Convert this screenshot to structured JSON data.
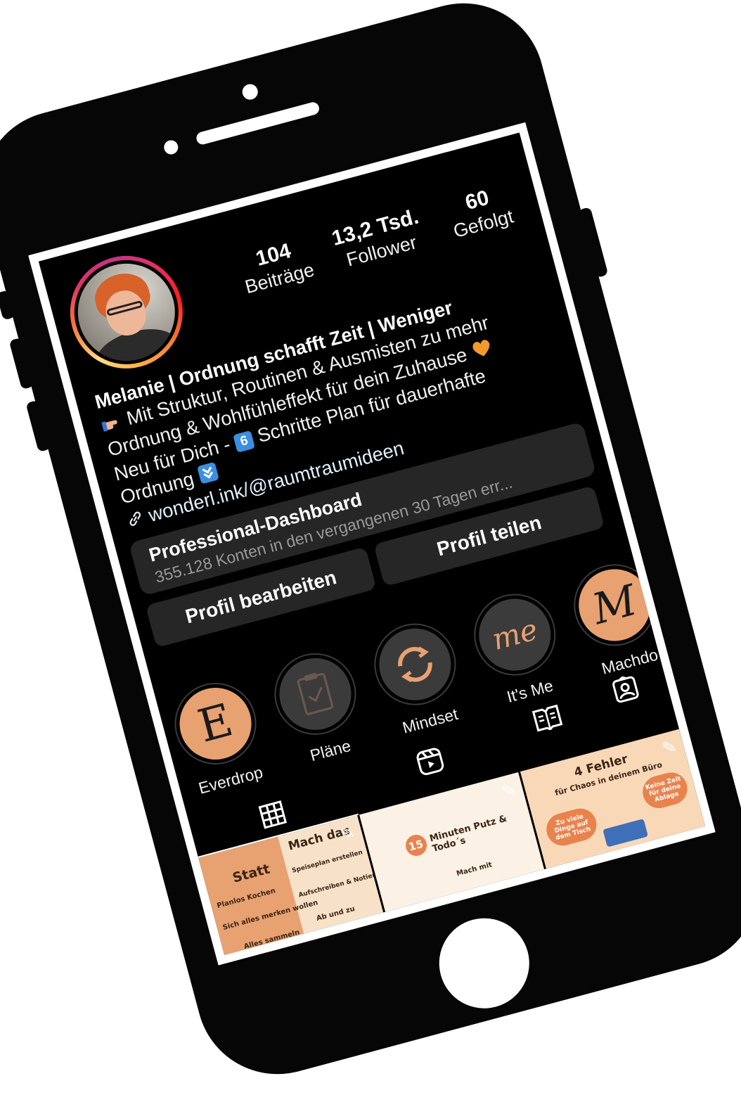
{
  "profile": {
    "stats": [
      {
        "value": "104",
        "label": "Beiträge"
      },
      {
        "value": "13,2 Tsd.",
        "label": "Follower"
      },
      {
        "value": "60",
        "label": "Gefolgt"
      }
    ],
    "bio": {
      "name": "Melanie | Ordnung schafft Zeit | Weniger",
      "line1": "Mit Struktur, Routinen & Ausmisten zu mehr",
      "line2": "Ordnung & Wohlfühleffekt für dein Zuhause",
      "line3_prefix": "Neu für Dich - ",
      "line3_number": "6",
      "line3_suffix": " Schritte Plan für dauerhafte",
      "line4": "Ordnung"
    },
    "link": "wonderl.ink/@raumtraumideen"
  },
  "dashboard": {
    "title": "Professional-Dashboard",
    "subtitle": "355.128 Konten in den vergangenen 30 Tagen err..."
  },
  "buttons": {
    "edit": "Profil bearbeiten",
    "share": "Profil teilen"
  },
  "highlights": [
    {
      "label": "Everdrop",
      "glyph": "E"
    },
    {
      "label": "Pläne"
    },
    {
      "label": "Mindset"
    },
    {
      "label": "It's Me",
      "glyph": "me"
    },
    {
      "label": "Machdo",
      "glyph": "M"
    }
  ],
  "tabs": [
    {
      "icon": "grid-icon"
    },
    {
      "icon": "reels-icon"
    },
    {
      "icon": "guide-icon"
    },
    {
      "icon": "tagged-icon"
    }
  ],
  "posts": [
    {
      "left_title": "Statt",
      "left_items": [
        "Planlos Kochen",
        "Sich alles merken wollen",
        "Alles sammeln"
      ],
      "right_title": "Mach das",
      "right_items": [
        "Speiseplan erstellen",
        "Aufschreiben & Notieren",
        "Ab und zu"
      ]
    },
    {
      "number": "15",
      "title": "Minuten Putz & Todo´s",
      "sub": "Mach mit"
    },
    {
      "title": "4 Fehler",
      "subtitle": "für Chaos in deinem Büro",
      "bubble_left": "Zu viele Dinge auf dem Tisch",
      "bubble_right": "Keine Zeit für deine Ablage"
    }
  ],
  "colors": {
    "screen_bg": "#000000",
    "button_bg": "#262626",
    "link": "#e0f1ff",
    "highlight_peach": "#e8a171",
    "highlight_gray": "#3b3b3b",
    "post_cream": "#f7e2c9"
  }
}
